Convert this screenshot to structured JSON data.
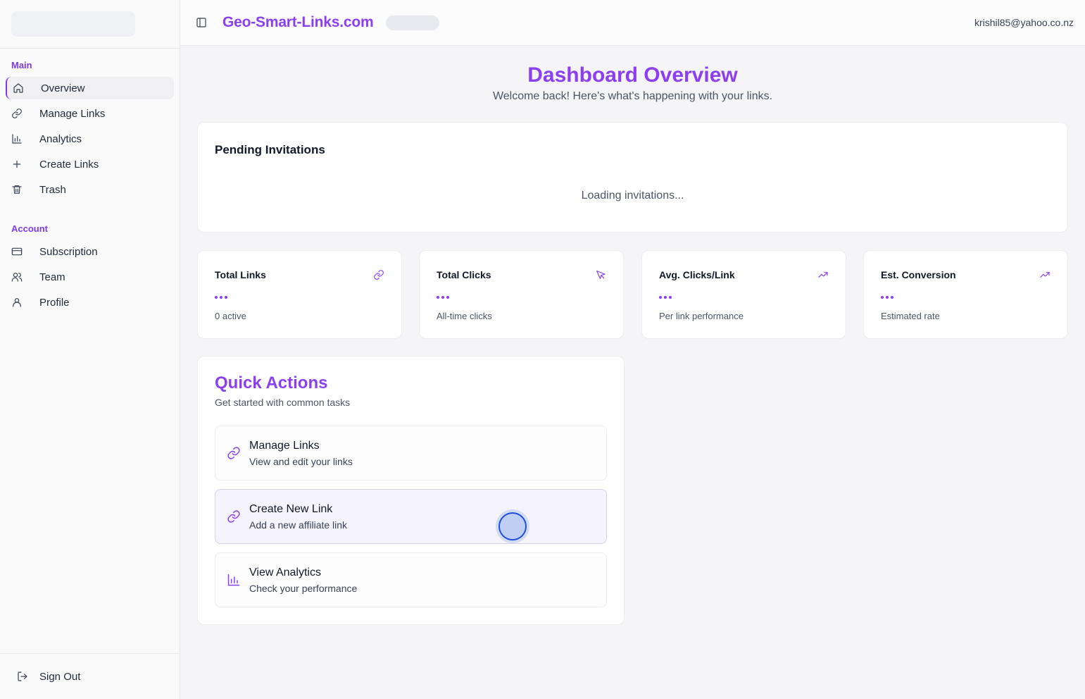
{
  "sidebar": {
    "sections": {
      "main_label": "Main",
      "account_label": "Account"
    },
    "main_items": [
      {
        "label": "Overview",
        "icon": "home-icon",
        "active": true
      },
      {
        "label": "Manage Links",
        "icon": "link-icon"
      },
      {
        "label": "Analytics",
        "icon": "bar-chart-icon"
      },
      {
        "label": "Create Links",
        "icon": "plus-icon"
      },
      {
        "label": "Trash",
        "icon": "trash-icon"
      }
    ],
    "account_items": [
      {
        "label": "Subscription",
        "icon": "credit-card-icon"
      },
      {
        "label": "Team",
        "icon": "users-icon"
      },
      {
        "label": "Profile",
        "icon": "user-icon"
      }
    ],
    "sign_out": "Sign Out"
  },
  "header": {
    "brand": "Geo-Smart-Links.com",
    "user_email": "krishil85@yahoo.co.nz"
  },
  "main": {
    "title": "Dashboard Overview",
    "subtitle": "Welcome back! Here's what's happening with your links.",
    "invitations": {
      "title": "Pending Invitations",
      "loading": "Loading invitations..."
    },
    "stats": [
      {
        "title": "Total Links",
        "sub": "0 active",
        "icon": "link-icon"
      },
      {
        "title": "Total Clicks",
        "sub": "All-time clicks",
        "icon": "mouse-pointer-icon"
      },
      {
        "title": "Avg. Clicks/Link",
        "sub": "Per link performance",
        "icon": "trending-up-icon"
      },
      {
        "title": "Est. Conversion",
        "sub": "Estimated rate",
        "icon": "trending-up-icon"
      }
    ],
    "quick_actions": {
      "title": "Quick Actions",
      "subtitle": "Get started with common tasks",
      "items": [
        {
          "title": "Manage Links",
          "desc": "View and edit your links",
          "icon": "link-icon"
        },
        {
          "title": "Create New Link",
          "desc": "Add a new affiliate link",
          "icon": "link-icon"
        },
        {
          "title": "View Analytics",
          "desc": "Check your performance",
          "icon": "bar-chart-icon"
        }
      ]
    }
  },
  "colors": {
    "accent": "#8b3ff0",
    "text": "#111827",
    "muted": "#4b5563"
  }
}
